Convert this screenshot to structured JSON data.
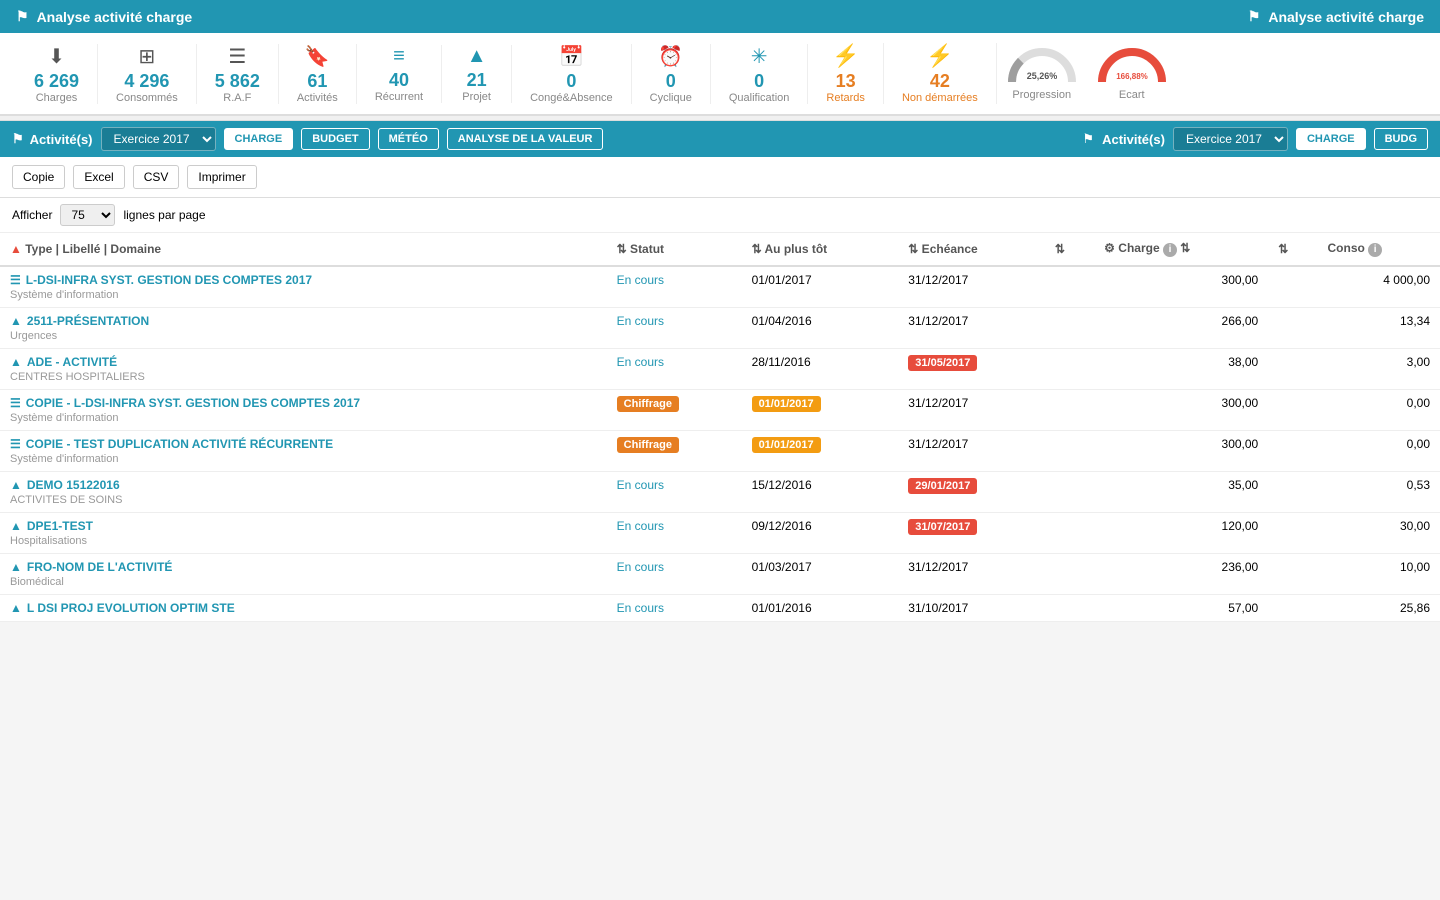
{
  "header": {
    "title": "Analyse activité charge",
    "icon": "flag-icon"
  },
  "stats": [
    {
      "icon": "download",
      "value": "6 269",
      "label": "Charges",
      "color": "blue"
    },
    {
      "icon": "grid",
      "value": "4 296",
      "label": "Consommés",
      "color": "blue"
    },
    {
      "icon": "list",
      "value": "5 862",
      "label": "R.A.F",
      "color": "blue"
    },
    {
      "icon": "bookmark",
      "value": "61",
      "label": "Activités",
      "color": "blue"
    },
    {
      "icon": "list2",
      "value": "40",
      "label": "Récurrent",
      "color": "blue"
    },
    {
      "icon": "road",
      "value": "21",
      "label": "Projet",
      "color": "blue"
    },
    {
      "icon": "calendar",
      "value": "0",
      "label": "Congé&Absence",
      "color": "blue"
    },
    {
      "icon": "clock",
      "value": "0",
      "label": "Cyclique",
      "color": "blue"
    },
    {
      "icon": "star",
      "value": "0",
      "label": "Qualification",
      "color": "blue"
    },
    {
      "icon": "bolt",
      "value": "13",
      "label": "Retards",
      "color": "orange"
    },
    {
      "icon": "bolt2",
      "value": "42",
      "label": "Non démarrées",
      "color": "orange"
    }
  ],
  "gauges": {
    "progression": {
      "label": "Progression",
      "value": "25,26%",
      "pct": 25.26
    },
    "ecart": {
      "label": "Ecart",
      "value": "166,88%",
      "pct": 100
    }
  },
  "activity_bar": {
    "title": "Activité(s)",
    "exercise": "Exercice 2017",
    "tabs": [
      "CHARGE",
      "BUDGET",
      "MÉTÉO",
      "ANALYSE DE LA VALEUR"
    ],
    "active_tab": "CHARGE"
  },
  "activity_bar_right": {
    "title": "Activité(s)",
    "exercise": "Exercice 2017",
    "tabs": [
      "CHARGE",
      "BUDG"
    ],
    "active_tab": "CHARGE"
  },
  "table_controls": {
    "buttons": [
      "Copie",
      "Excel",
      "CSV",
      "Imprimer"
    ]
  },
  "show_lines": {
    "label_before": "Afficher",
    "value": "75",
    "label_after": "lignes par page"
  },
  "columns": [
    {
      "label": "Type | Libellé | Domaine",
      "sortable": true,
      "sort_up": true
    },
    {
      "label": "Statut",
      "sortable": true
    },
    {
      "label": "Au plus tôt",
      "sortable": true
    },
    {
      "label": "Echéance",
      "sortable": true
    },
    {
      "label": "",
      "sortable": true
    },
    {
      "label": "Charge",
      "sortable": true,
      "has_gear": true,
      "has_info": true
    },
    {
      "label": "",
      "sortable": true
    },
    {
      "label": "Conso",
      "has_info": true
    }
  ],
  "rows": [
    {
      "type": "list",
      "title": "L-DSI-INFRA SYST. GESTION DES COMPTES 2017",
      "domain": "Système d'information",
      "statut": "En cours",
      "au_plus_tot": "01/01/2017",
      "echeance": "31/12/2017",
      "echeance_badge": false,
      "echeance_color": "",
      "charge": "300,00",
      "conso": "4 000,00"
    },
    {
      "type": "proj",
      "title": "2511-PRÉSENTATION",
      "domain": "Urgences",
      "statut": "En cours",
      "au_plus_tot": "01/04/2016",
      "echeance": "31/12/2017",
      "echeance_badge": false,
      "echeance_color": "",
      "charge": "266,00",
      "conso": "13,34"
    },
    {
      "type": "proj",
      "title": "ADE - ACTIVITÉ",
      "domain": "CENTRES HOSPITALIERS",
      "statut": "En cours",
      "au_plus_tot": "28/11/2016",
      "echeance": "31/05/2017",
      "echeance_badge": true,
      "echeance_color": "red",
      "charge": "38,00",
      "conso": "3,00"
    },
    {
      "type": "list",
      "title": "COPIE - L-DSI-INFRA SYST. GESTION DES COMPTES 2017",
      "domain": "Système d'information",
      "statut": "Chiffrage",
      "statut_badge": true,
      "statut_color": "orange",
      "au_plus_tot": "01/01/2017",
      "au_plus_tot_badge": true,
      "au_plus_tot_color": "orange",
      "echeance": "31/12/2017",
      "echeance_badge": false,
      "charge": "300,00",
      "conso": "0,00"
    },
    {
      "type": "list",
      "title": "COPIE - TEST DUPLICATION ACTIVITÉ RÉCURRENTE",
      "domain": "Système d'information",
      "statut": "Chiffrage",
      "statut_badge": true,
      "statut_color": "orange",
      "au_plus_tot": "01/01/2017",
      "au_plus_tot_badge": true,
      "au_plus_tot_color": "orange",
      "echeance": "31/12/2017",
      "echeance_badge": false,
      "charge": "300,00",
      "conso": "0,00"
    },
    {
      "type": "proj",
      "title": "DEMO 15122016",
      "domain": "ACTIVITES DE SOINS",
      "statut": "En cours",
      "au_plus_tot": "15/12/2016",
      "echeance": "29/01/2017",
      "echeance_badge": true,
      "echeance_color": "red",
      "charge": "35,00",
      "conso": "0,53"
    },
    {
      "type": "proj",
      "title": "DPE1-TEST",
      "domain": "Hospitalisations",
      "statut": "En cours",
      "au_plus_tot": "09/12/2016",
      "echeance": "31/07/2017",
      "echeance_badge": true,
      "echeance_color": "red",
      "charge": "120,00",
      "conso": "30,00"
    },
    {
      "type": "proj",
      "title": "FRO-NOM DE L'ACTIVITÉ",
      "domain": "Biomédical",
      "statut": "En cours",
      "au_plus_tot": "01/03/2017",
      "echeance": "31/12/2017",
      "echeance_badge": false,
      "charge": "236,00",
      "conso": "10,00"
    },
    {
      "type": "proj",
      "title": "L DSI PROJ EVOLUTION OPTIM STE",
      "domain": "",
      "statut": "En cours",
      "au_plus_tot": "01/01/2016",
      "echeance": "31/10/2017",
      "echeance_badge": false,
      "charge": "57,00",
      "conso": "25,86"
    }
  ]
}
